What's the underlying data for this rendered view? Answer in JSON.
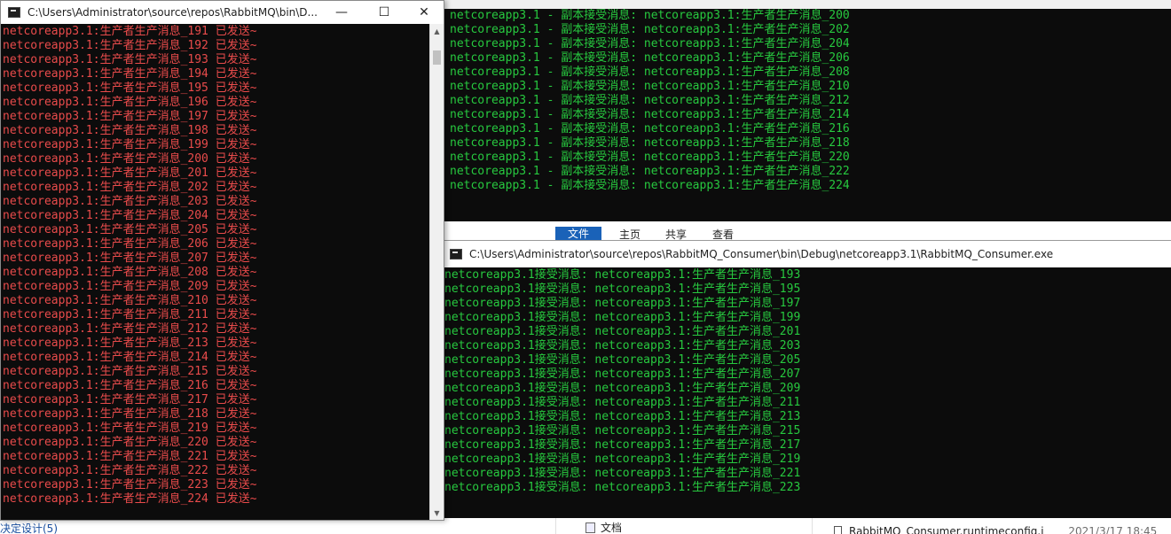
{
  "producer_window": {
    "title": "C:\\Users\\Administrator\\source\\repos\\RabbitMQ\\bin\\D...",
    "text_color": "#e94b4b",
    "lines": [
      "netcoreapp3.1:生产者生产消息_191 已发送~",
      "netcoreapp3.1:生产者生产消息_192 已发送~",
      "netcoreapp3.1:生产者生产消息_193 已发送~",
      "netcoreapp3.1:生产者生产消息_194 已发送~",
      "netcoreapp3.1:生产者生产消息_195 已发送~",
      "netcoreapp3.1:生产者生产消息_196 已发送~",
      "netcoreapp3.1:生产者生产消息_197 已发送~",
      "netcoreapp3.1:生产者生产消息_198 已发送~",
      "netcoreapp3.1:生产者生产消息_199 已发送~",
      "netcoreapp3.1:生产者生产消息_200 已发送~",
      "netcoreapp3.1:生产者生产消息_201 已发送~",
      "netcoreapp3.1:生产者生产消息_202 已发送~",
      "netcoreapp3.1:生产者生产消息_203 已发送~",
      "netcoreapp3.1:生产者生产消息_204 已发送~",
      "netcoreapp3.1:生产者生产消息_205 已发送~",
      "netcoreapp3.1:生产者生产消息_206 已发送~",
      "netcoreapp3.1:生产者生产消息_207 已发送~",
      "netcoreapp3.1:生产者生产消息_208 已发送~",
      "netcoreapp3.1:生产者生产消息_209 已发送~",
      "netcoreapp3.1:生产者生产消息_210 已发送~",
      "netcoreapp3.1:生产者生产消息_211 已发送~",
      "netcoreapp3.1:生产者生产消息_212 已发送~",
      "netcoreapp3.1:生产者生产消息_213 已发送~",
      "netcoreapp3.1:生产者生产消息_214 已发送~",
      "netcoreapp3.1:生产者生产消息_215 已发送~",
      "netcoreapp3.1:生产者生产消息_216 已发送~",
      "netcoreapp3.1:生产者生产消息_217 已发送~",
      "netcoreapp3.1:生产者生产消息_218 已发送~",
      "netcoreapp3.1:生产者生产消息_219 已发送~",
      "netcoreapp3.1:生产者生产消息_220 已发送~",
      "netcoreapp3.1:生产者生产消息_221 已发送~",
      "netcoreapp3.1:生产者生产消息_222 已发送~",
      "netcoreapp3.1:生产者生产消息_223 已发送~",
      "netcoreapp3.1:生产者生产消息_224 已发送~"
    ],
    "controls": {
      "minimize": "—",
      "maximize": "☐",
      "close": "✕"
    }
  },
  "replica_window": {
    "text_color": "#27c93f",
    "lines": [
      "netcoreapp3.1 - 副本接受消息: netcoreapp3.1:生产者生产消息_200",
      "netcoreapp3.1 - 副本接受消息: netcoreapp3.1:生产者生产消息_202",
      "netcoreapp3.1 - 副本接受消息: netcoreapp3.1:生产者生产消息_204",
      "netcoreapp3.1 - 副本接受消息: netcoreapp3.1:生产者生产消息_206",
      "netcoreapp3.1 - 副本接受消息: netcoreapp3.1:生产者生产消息_208",
      "netcoreapp3.1 - 副本接受消息: netcoreapp3.1:生产者生产消息_210",
      "netcoreapp3.1 - 副本接受消息: netcoreapp3.1:生产者生产消息_212",
      "netcoreapp3.1 - 副本接受消息: netcoreapp3.1:生产者生产消息_214",
      "netcoreapp3.1 - 副本接受消息: netcoreapp3.1:生产者生产消息_216",
      "netcoreapp3.1 - 副本接受消息: netcoreapp3.1:生产者生产消息_218",
      "netcoreapp3.1 - 副本接受消息: netcoreapp3.1:生产者生产消息_220",
      "netcoreapp3.1 - 副本接受消息: netcoreapp3.1:生产者生产消息_222",
      "netcoreapp3.1 - 副本接受消息: netcoreapp3.1:生产者生产消息_224"
    ]
  },
  "explorer_ribbon": {
    "tabs": [
      "文件",
      "主页",
      "共享",
      "查看"
    ],
    "accent": "#1a62b8"
  },
  "consumer_window": {
    "title": "C:\\Users\\Administrator\\source\\repos\\RabbitMQ_Consumer\\bin\\Debug\\netcoreapp3.1\\RabbitMQ_Consumer.exe",
    "text_color": "#27c93f",
    "lines": [
      "netcoreapp3.1接受消息: netcoreapp3.1:生产者生产消息_193",
      "netcoreapp3.1接受消息: netcoreapp3.1:生产者生产消息_195",
      "netcoreapp3.1接受消息: netcoreapp3.1:生产者生产消息_197",
      "netcoreapp3.1接受消息: netcoreapp3.1:生产者生产消息_199",
      "netcoreapp3.1接受消息: netcoreapp3.1:生产者生产消息_201",
      "netcoreapp3.1接受消息: netcoreapp3.1:生产者生产消息_203",
      "netcoreapp3.1接受消息: netcoreapp3.1:生产者生产消息_205",
      "netcoreapp3.1接受消息: netcoreapp3.1:生产者生产消息_207",
      "netcoreapp3.1接受消息: netcoreapp3.1:生产者生产消息_209",
      "netcoreapp3.1接受消息: netcoreapp3.1:生产者生产消息_211",
      "netcoreapp3.1接受消息: netcoreapp3.1:生产者生产消息_213",
      "netcoreapp3.1接受消息: netcoreapp3.1:生产者生产消息_215",
      "netcoreapp3.1接受消息: netcoreapp3.1:生产者生产消息_217",
      "netcoreapp3.1接受消息: netcoreapp3.1:生产者生产消息_219",
      "netcoreapp3.1接受消息: netcoreapp3.1:生产者生产消息_221",
      "netcoreapp3.1接受消息: netcoreapp3.1:生产者生产消息_223"
    ]
  },
  "explorer_files": {
    "folder_label": "文档",
    "file_name": "RabbitMQ_Consumer.runtimeconfig.j",
    "file_date": "2021/3/17 18:45"
  },
  "left_panel": {
    "item_label": "决定设计(5)"
  }
}
